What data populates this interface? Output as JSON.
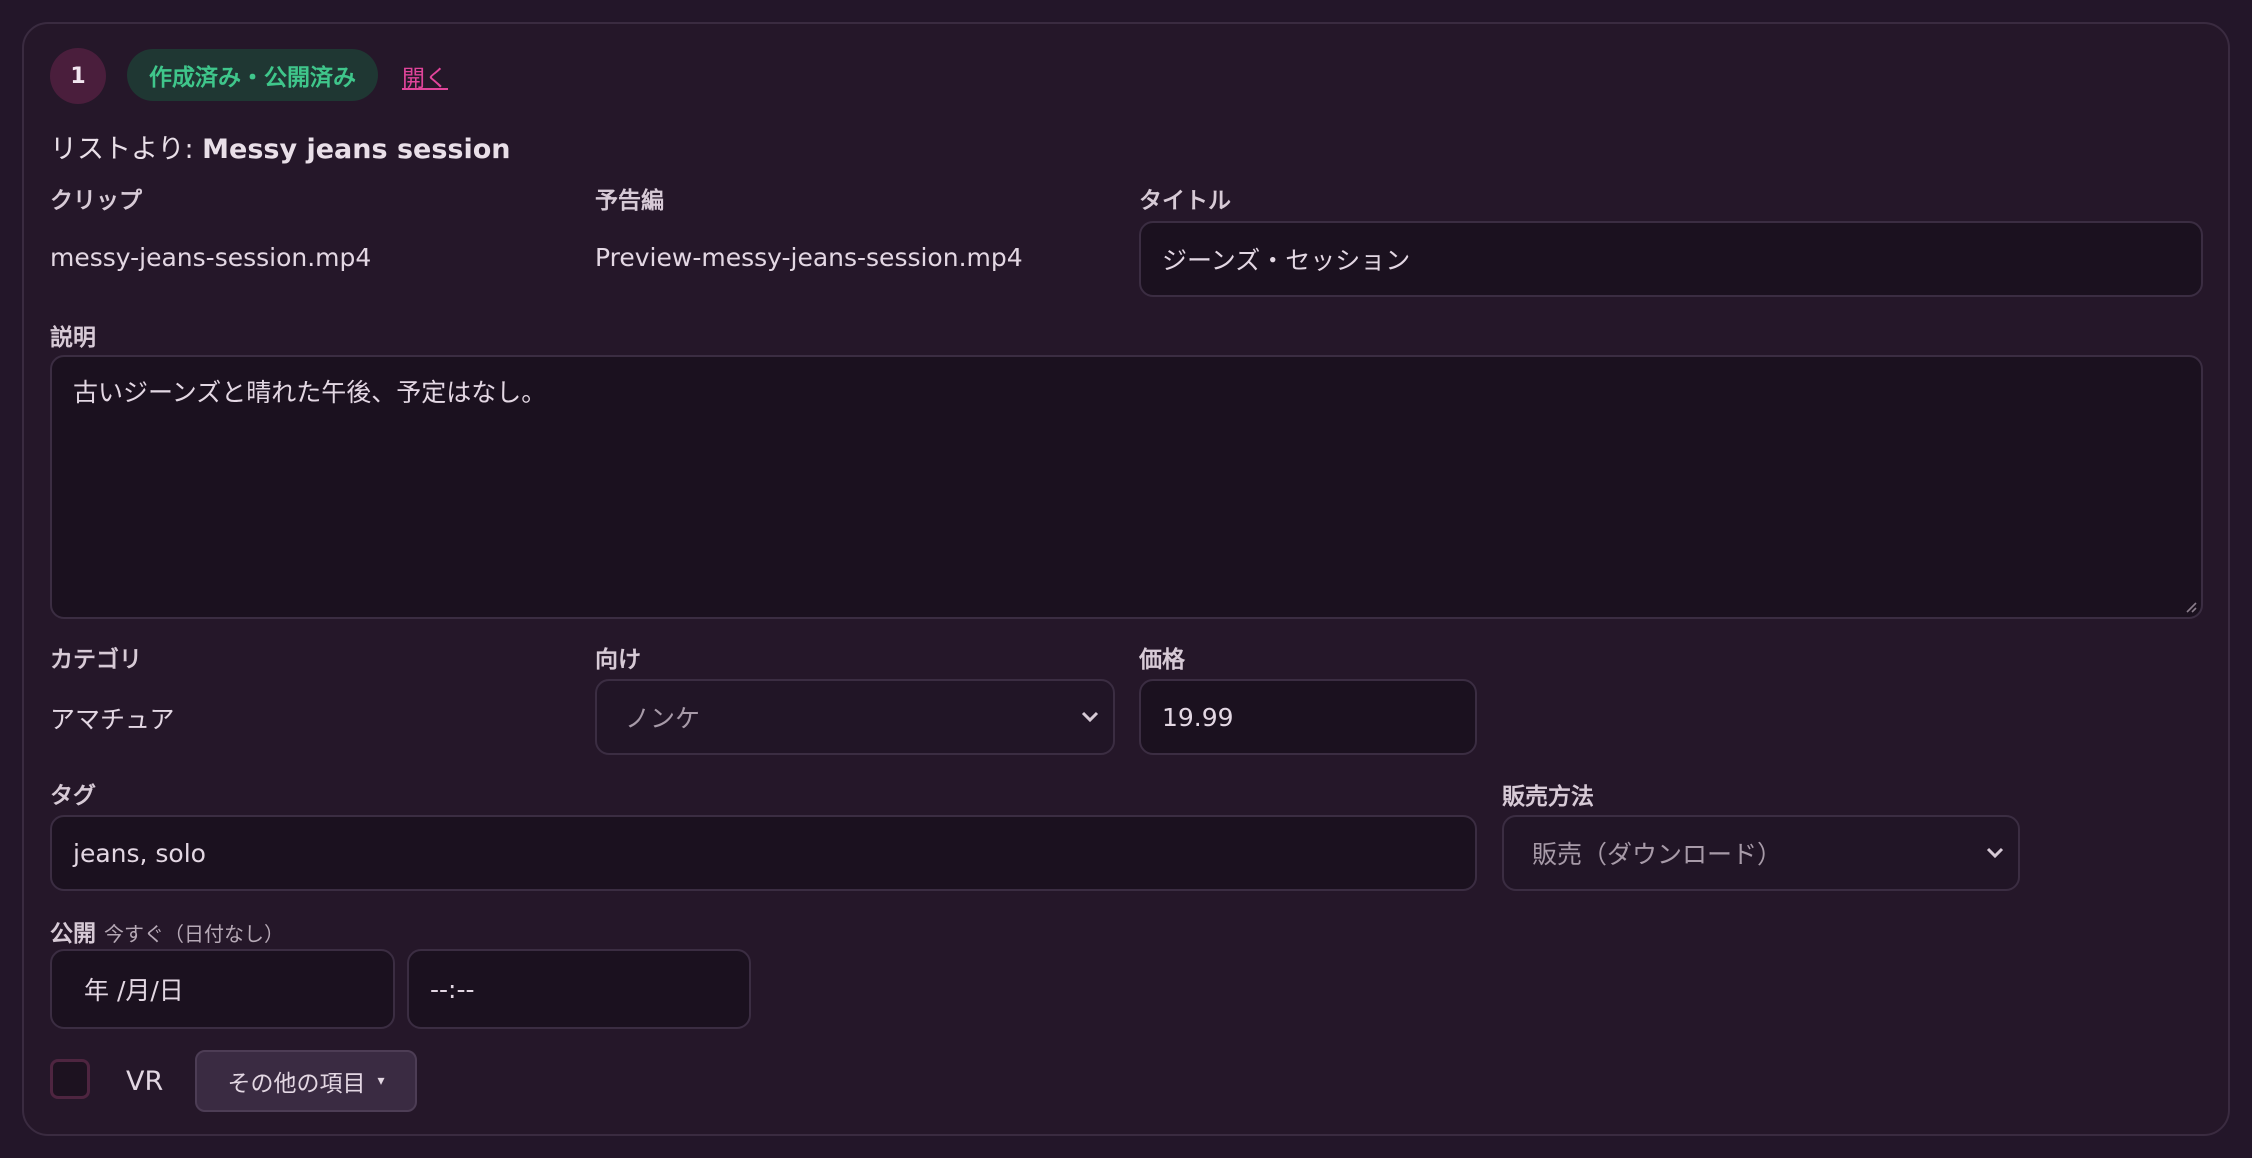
{
  "header": {
    "item_number": "1",
    "status": "作成済み・公開済み",
    "open_link": "開く",
    "heading_prefix": "リストより: ",
    "heading_name": "Messy jeans session"
  },
  "clip": {
    "label": "クリップ",
    "value": "messy-jeans-session.mp4"
  },
  "trailer": {
    "label": "予告編",
    "value": "Preview-messy-jeans-session.mp4"
  },
  "title": {
    "label": "タイトル",
    "value": "ジーンズ・セッション"
  },
  "description": {
    "label": "説明",
    "value": "古いジーンズと晴れた午後、予定はなし。"
  },
  "category": {
    "label": "カテゴリ",
    "value": "アマチュア"
  },
  "audience": {
    "label": "向け",
    "selected": "ノンケ"
  },
  "price": {
    "label": "価格",
    "value": "19.99"
  },
  "tags": {
    "label": "タグ",
    "value": "jeans, solo"
  },
  "sales_method": {
    "label": "販売方法",
    "selected": "販売（ダウンロード）"
  },
  "publish": {
    "label": "公開",
    "sub": "今すぐ（日付なし）",
    "date_placeholder": "年 /月/日",
    "time_placeholder": "--:--"
  },
  "vr": {
    "label": "VR",
    "checked": false
  },
  "more_button": {
    "label": "その他の項目",
    "caret": "▾"
  },
  "colors": {
    "background": "#231629",
    "status_text": "#3fc68b",
    "link": "#e0449a",
    "badge_bg": "#4a1e3c"
  }
}
